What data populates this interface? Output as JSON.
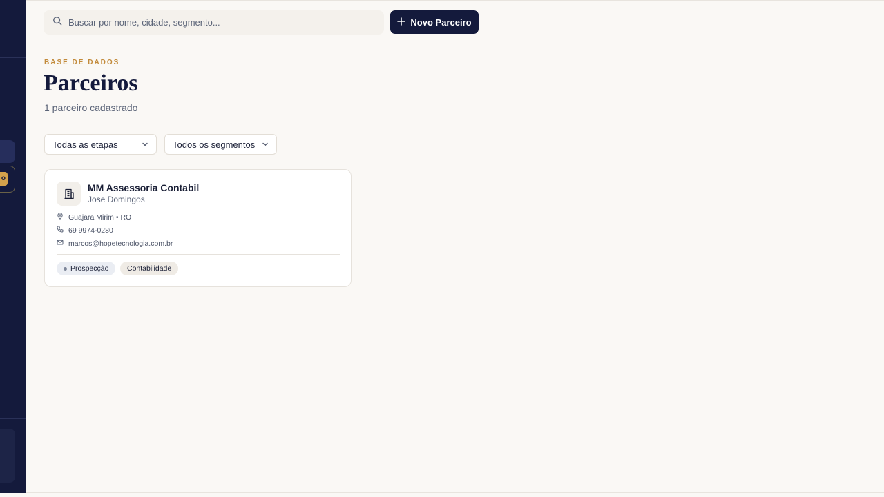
{
  "sidebar": {
    "badge_text": "o"
  },
  "topbar": {
    "search_placeholder": "Buscar por nome, cidade, segmento...",
    "new_button_label": "Novo Parceiro"
  },
  "header": {
    "eyebrow": "BASE DE DADOS",
    "title": "Parceiros",
    "subtitle": "1 parceiro cadastrado"
  },
  "filters": {
    "stage_selected": "Todas as etapas",
    "segment_selected": "Todos os segmentos"
  },
  "partners": [
    {
      "name": "MM Assessoria Contabil",
      "contact": "Jose Domingos",
      "location": "Guajara Mirim • RO",
      "phone": "69 9974-0280",
      "email": "marcos@hopetecnologia.com.br",
      "stage": "Prospecção",
      "segment": "Contabilidade",
      "icon": "building-icon"
    }
  ],
  "colors": {
    "sidebar_bg": "#141a3c",
    "accent": "#c28a3a",
    "badge": "#d4a24c",
    "page_bg": "#faf8f5"
  }
}
